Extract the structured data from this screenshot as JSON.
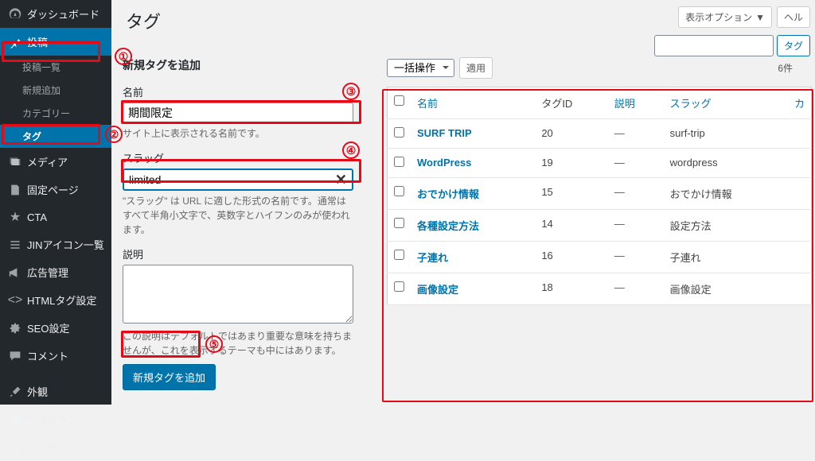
{
  "page_title": "タグ",
  "screen_options": "表示オプション",
  "help": "ヘル",
  "search_btn": "タグ",
  "sidebar": {
    "dashboard": "ダッシュボード",
    "posts": "投稿",
    "posts_sub": [
      "投稿一覧",
      "新規追加",
      "カテゴリー",
      "タグ"
    ],
    "media": "メディア",
    "pages": "固定ページ",
    "cta": "CTA",
    "jin_icons": "JINアイコン一覧",
    "ads": "広告管理",
    "html_tags": "HTMLタグ設定",
    "seo": "SEO設定",
    "comments": "コメント",
    "appearance": "外観",
    "plugins": "プラグイン",
    "users": "ユーザー"
  },
  "form": {
    "heading": "新規タグを追加",
    "name_label": "名前",
    "name_value": "期間限定",
    "name_desc": "サイト上に表示される名前です。",
    "slug_label": "スラッグ",
    "slug_value": "limited",
    "slug_desc": "\"スラッグ\" は URL に適した形式の名前です。通常はすべて半角小文字で、英数字とハイフンのみが使われます。",
    "desc_label": "説明",
    "desc_desc": "この説明はデフォルトではあまり重要な意味を持ちませんが、これを表示するテーマも中にはあります。",
    "submit": "新規タグを追加"
  },
  "bulk": {
    "select": "一括操作",
    "apply": "適用"
  },
  "count_text": "6件",
  "table": {
    "headers": {
      "name": "名前",
      "tagid": "タグID",
      "desc": "説明",
      "slug": "スラッグ",
      "count": "カ"
    },
    "rows": [
      {
        "name": "SURF TRIP",
        "id": "20",
        "desc": "―",
        "slug": "surf-trip"
      },
      {
        "name": "WordPress",
        "id": "19",
        "desc": "―",
        "slug": "wordpress"
      },
      {
        "name": "おでかけ情報",
        "id": "15",
        "desc": "―",
        "slug": "おでかけ情報"
      },
      {
        "name": "各種設定方法",
        "id": "14",
        "desc": "―",
        "slug": "設定方法"
      },
      {
        "name": "子連れ",
        "id": "16",
        "desc": "―",
        "slug": "子連れ"
      },
      {
        "name": "画像設定",
        "id": "18",
        "desc": "―",
        "slug": "画像設定"
      }
    ]
  }
}
